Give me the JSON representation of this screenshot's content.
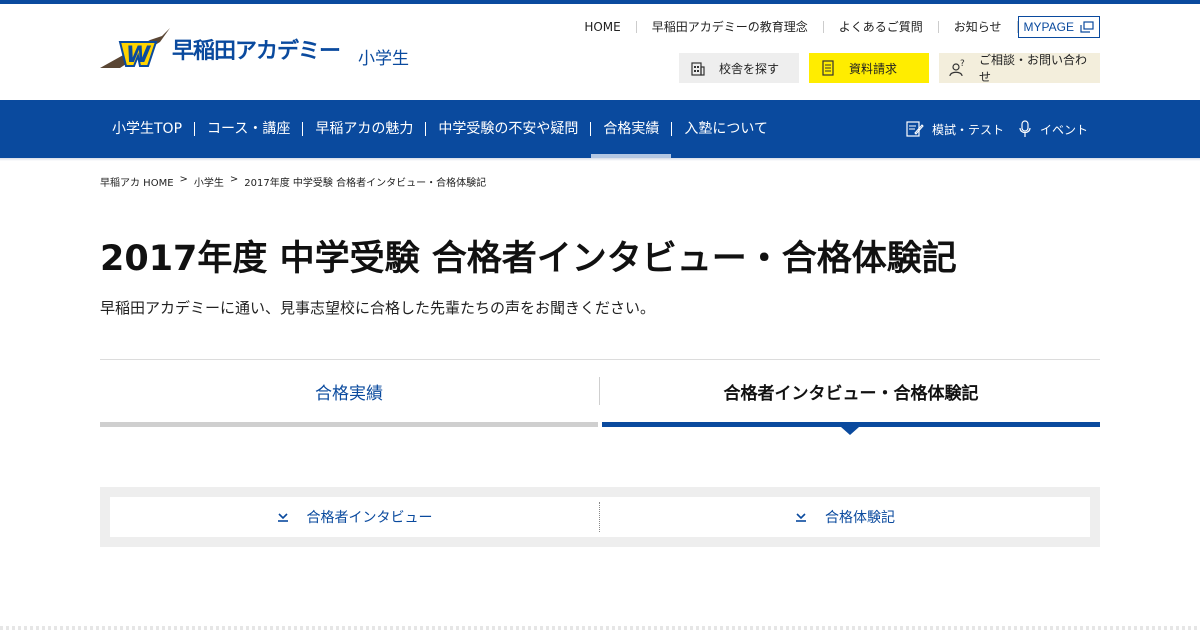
{
  "brand": {
    "logo_text": "早稲田アカデミー",
    "sub": "小学生",
    "color": "#0a4a9e",
    "accent": "#ffed00"
  },
  "util_nav": {
    "items": [
      "HOME",
      "早稲田アカデミーの教育理念",
      "よくあるご質問",
      "お知らせ"
    ],
    "mypage": "MYPAGE"
  },
  "actions": {
    "search": "校舎を探す",
    "request": "資料請求",
    "contact": "ご相談・お問い合わせ"
  },
  "main_nav": {
    "items": [
      "小学生TOP",
      "コース・講座",
      "早稲アカの魅力",
      "中学受験の不安や疑問",
      "合格実績",
      "入塾について"
    ],
    "active_index": 4,
    "right": [
      "模試・テスト",
      "イベント"
    ]
  },
  "breadcrumb": [
    "早稲アカ HOME",
    "小学生",
    "2017年度 中学受験 合格者インタビュー・合格体験記"
  ],
  "page": {
    "title": "2017年度 中学受験 合格者インタビュー・合格体験記",
    "lead": "早稲田アカデミーに通い、見事志望校に合格した先輩たちの声をお聞きください。"
  },
  "tabs": [
    {
      "label": "合格実績",
      "active": false
    },
    {
      "label": "合格者インタビュー・合格体験記",
      "active": true
    }
  ],
  "anchors": [
    "合格者インタビュー",
    "合格体験記"
  ]
}
